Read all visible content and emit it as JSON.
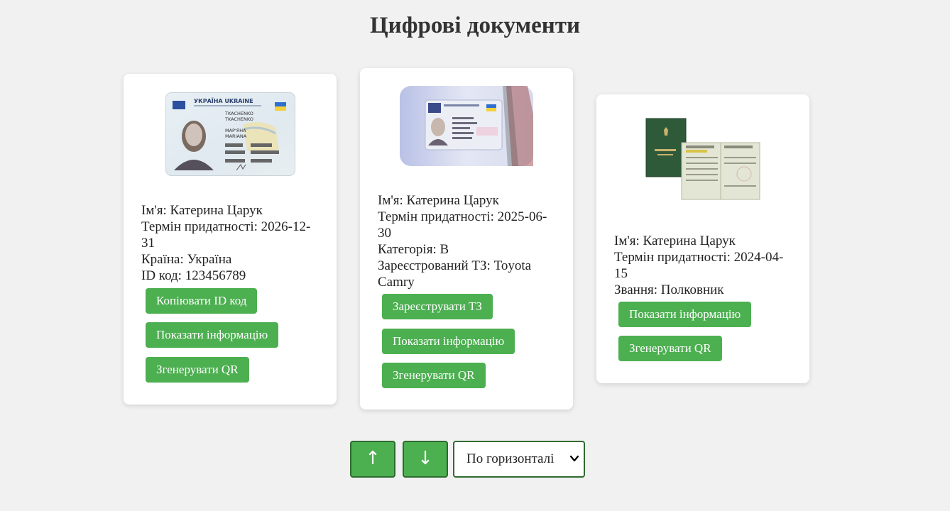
{
  "page": {
    "title": "Цифрові документи"
  },
  "cards": [
    {
      "image": "id-card-photo",
      "fields": [
        "Ім'я: Катерина Царук",
        "Термін придатності: 2026-12-31",
        "Країна: Україна",
        "ID код: 123456789"
      ],
      "buttons": [
        "Копіювати ID код",
        "Показати інформацію",
        "Згенерувати QR"
      ],
      "image_text": {
        "header": "УКРАЇНА UKRAINE",
        "names": [
          "TKACHENKO",
          "МАР'ЯНА",
          "MARIANA"
        ]
      }
    },
    {
      "image": "driver-license-photo",
      "fields": [
        "Ім'я: Катерина Царук",
        "Термін придатності: 2025-06-30",
        "Категорія: B",
        "Зареєстрований ТЗ: Toyota Camry"
      ],
      "buttons": [
        "Зареєструвати ТЗ",
        "Показати інформацію",
        "Згенерувати QR"
      ]
    },
    {
      "image": "military-id-photo",
      "fields": [
        "Ім'я: Катерина Царук",
        "Термін придатності: 2024-04-15",
        "Звання: Полковник"
      ],
      "buttons": [
        "Показати інформацію",
        "Згенерувати QR"
      ]
    }
  ],
  "controls": {
    "up_label": "↑",
    "down_label": "↓",
    "layout_select": {
      "selected": "По горизонталі"
    }
  },
  "colors": {
    "accent": "#4caf50",
    "accent_border": "#2e6b2f",
    "background": "#f1f1f1"
  }
}
